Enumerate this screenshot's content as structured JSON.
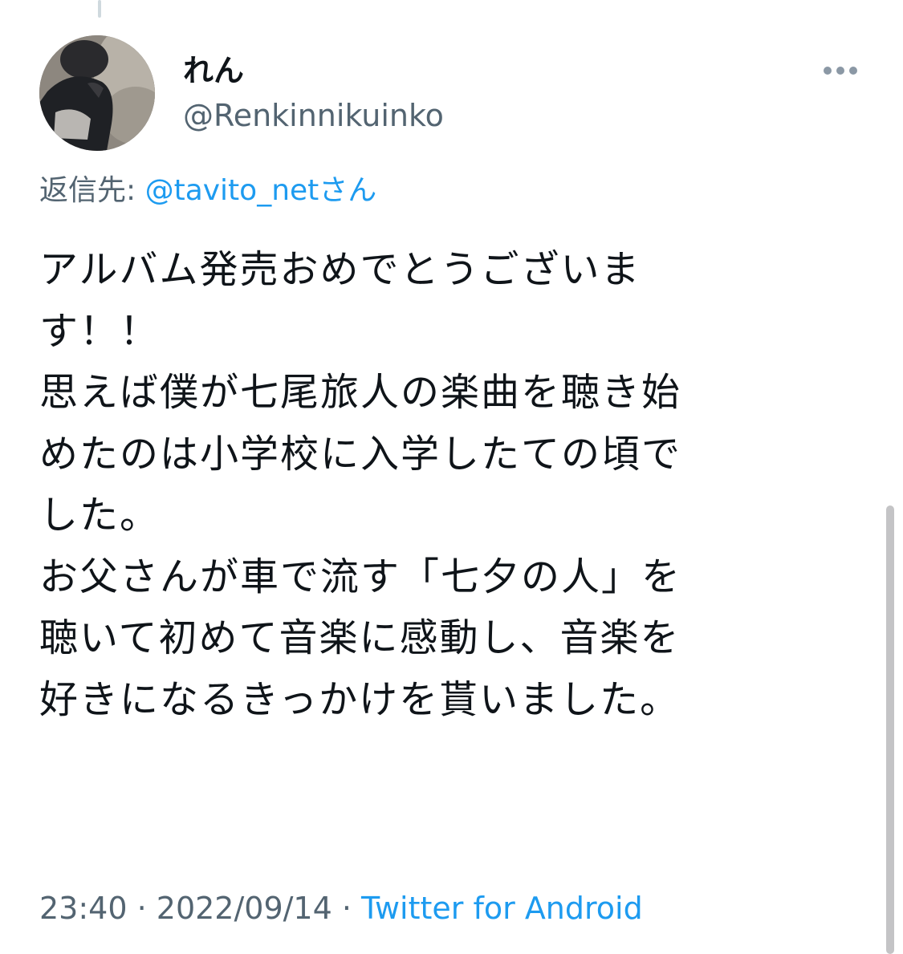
{
  "tweet": {
    "display_name": "れん",
    "handle": "@Renkinnikuinko",
    "reply_prefix": "返信先: ",
    "reply_mention": "@tavito_net",
    "reply_suffix": "さん",
    "body_lines": [
      "アルバム発売おめでとうございま",
      "す！！",
      "思えば僕が七尾旅人の楽曲を聴き始",
      "めたのは小学校に入学したての頃で",
      "した。",
      "お父さんが車で流す「七夕の人」を",
      "聴いて初めて音楽に感動し、音楽を",
      "好きになるきっかけを貰いました。"
    ],
    "time": "23:40",
    "separator": " · ",
    "date": "2022/09/14",
    "source": "Twitter for Android"
  },
  "icons": {
    "more": "more-horizontal-icon",
    "avatar": "user-avatar-photo"
  },
  "colors": {
    "text_primary": "#0f1419",
    "text_secondary": "#536471",
    "accent": "#1d9bf0",
    "thread_line": "#cfd9de",
    "scrollbar": "#c4c4c6"
  }
}
